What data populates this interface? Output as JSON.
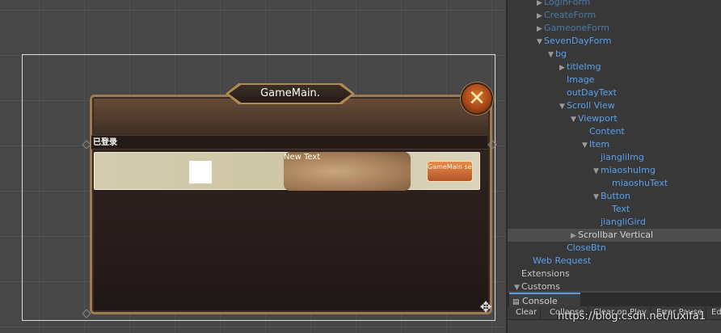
{
  "scene": {
    "title": "GameMain.",
    "close_glyph": "✕",
    "scroll_header": "已登录",
    "item_text": "New Text",
    "item_button": "GameMain sevenday g",
    "gizmo_glyph": "✥"
  },
  "hierarchy": {
    "items": [
      {
        "label": "LoginForm",
        "arrow": "▶",
        "style": "dim"
      },
      {
        "label": "CreateForm",
        "arrow": "▶",
        "style": "dim"
      },
      {
        "label": "GameoneForm",
        "arrow": "▶",
        "style": "dim"
      },
      {
        "label": "SevenDayForm",
        "arrow": "▼",
        "style": "normal"
      },
      {
        "label": "bg",
        "arrow": "▼",
        "style": "normal"
      },
      {
        "label": "titleImg",
        "arrow": "▶",
        "style": "normal"
      },
      {
        "label": "Image",
        "arrow": "",
        "style": "normal"
      },
      {
        "label": "outDayText",
        "arrow": "",
        "style": "normal"
      },
      {
        "label": "Scroll View",
        "arrow": "▼",
        "style": "normal"
      },
      {
        "label": "Viewport",
        "arrow": "▼",
        "style": "normal"
      },
      {
        "label": "Content",
        "arrow": "",
        "style": "normal"
      },
      {
        "label": "Item",
        "arrow": "▼",
        "style": "normal"
      },
      {
        "label": "jiangliImg",
        "arrow": "",
        "style": "normal"
      },
      {
        "label": "miaoshuImg",
        "arrow": "▼",
        "style": "normal"
      },
      {
        "label": "miaoshuText",
        "arrow": "",
        "style": "normal"
      },
      {
        "label": "Button",
        "arrow": "▼",
        "style": "normal"
      },
      {
        "label": "Text",
        "arrow": "",
        "style": "normal"
      },
      {
        "label": "jiangliGird",
        "arrow": "",
        "style": "normal"
      },
      {
        "label": "Scrollbar Vertical",
        "arrow": "▶",
        "style": "selected"
      },
      {
        "label": "CloseBtn",
        "arrow": "",
        "style": "normal"
      },
      {
        "label": "Web Request",
        "arrow": "",
        "style": "normal"
      },
      {
        "label": "Extensions",
        "arrow": "",
        "style": "plain"
      },
      {
        "label": "Customs",
        "arrow": "▼",
        "style": "plain"
      }
    ]
  },
  "console": {
    "tab_label": "Console",
    "buttons": [
      "Clear",
      "Collapse",
      "Clear on Play",
      "Error Pause",
      "Ed"
    ]
  },
  "watermark": "https://blog.csdn.net/luxifa1"
}
